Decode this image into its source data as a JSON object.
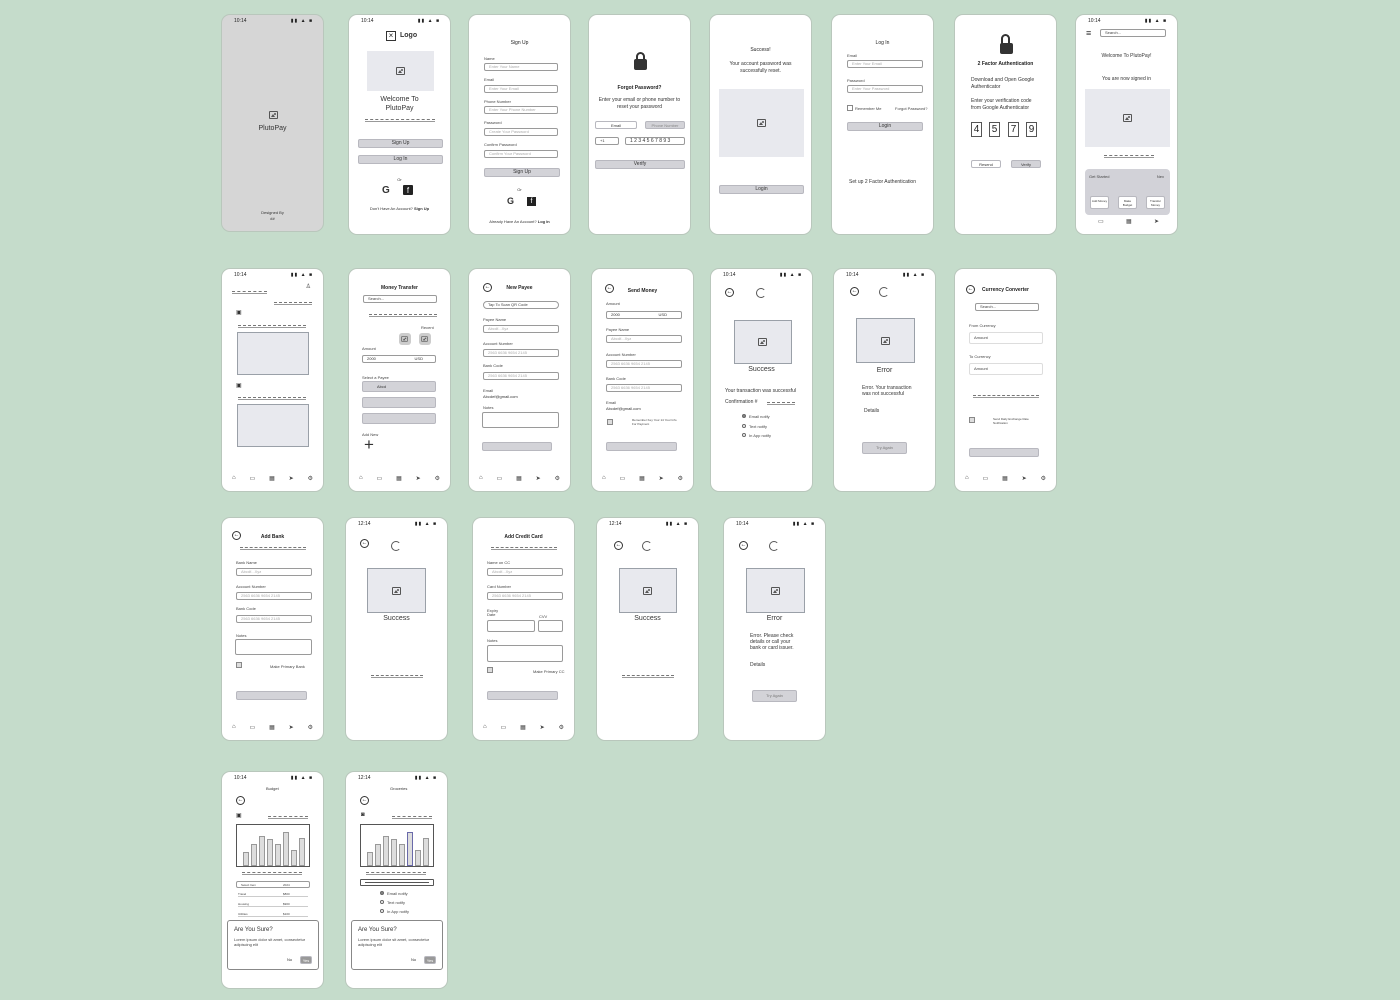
{
  "time": "10:14",
  "time_alt": "12:14",
  "status_icons": "▮▮ ▲ ■",
  "icons": {
    "image": "image-icon",
    "google": "G",
    "facebook": "f",
    "lock": "lock-icon",
    "menu": "≡",
    "plus": "+",
    "back": "←",
    "eye": "◉",
    "chevron": "∨"
  },
  "splash": {
    "brand": "PlutoPay",
    "designed_by": "Designed By",
    "designer": "##"
  },
  "welcome": {
    "logo": "Logo",
    "title": "Welcome To PlutoPay",
    "signup": "Sign Up",
    "login": "Log In",
    "or": "Or",
    "footer": "Don't Have An Account?",
    "footer_link": "Sign Up"
  },
  "signup": {
    "title": "Sign Up",
    "name_label": "Name",
    "name_ph": "Enter Your Name",
    "email_label": "Email",
    "email_ph": "Enter Your Email",
    "phone_label": "Phone Number",
    "phone_ph": "Enter Your Phone Number",
    "password_label": "Password",
    "password_ph": "Create Your Password",
    "confirm_label": "Confirm Password",
    "confirm_ph": "Confirm Your Password",
    "button": "Sign Up",
    "or": "Or",
    "footer": "Already Have An Account?",
    "footer_link": "Log In"
  },
  "forgot": {
    "title": "Forgot Password?",
    "desc": "Enter your email or phone number to reset your password",
    "tab_email": "Email",
    "tab_phone": "Phone Number",
    "code": "+1",
    "phone": "1 2 3 4 5 6 7 8 9 3",
    "button": "Verify"
  },
  "success_reset": {
    "title": "Success!",
    "desc": "Your account password was successfully reset.",
    "button": "Login"
  },
  "login": {
    "title": "Log In",
    "email_label": "Email",
    "email_ph": "Enter Your Email",
    "password_label": "Password",
    "password_ph": "Enter Your Password",
    "remember": "Remember Me",
    "forgot": "Forgot Password?",
    "button": "Login",
    "twofa": "Set up 2 Factor Authentication"
  },
  "twofa": {
    "title": "2 Factor Authentication",
    "desc1": "Download and Open Google Authenticator",
    "desc2": "Enter your verification code from Google Authenticator",
    "digits": [
      "4",
      "5",
      "7",
      "9"
    ],
    "resend": "Resend",
    "verify": "Verify"
  },
  "home": {
    "search_ph": "Search...",
    "title": "Welcome To PlutoPay!",
    "subtitle": "You are now signed in",
    "card_title": "Get Started",
    "card_step": "Nex",
    "actions": [
      "Add Money",
      "Make Budget",
      "Transfer Money"
    ]
  },
  "transfer": {
    "title": "Money Transfer",
    "search_ph": "Search...",
    "recent": "Recent",
    "amount_label": "Amount",
    "amount": "2000",
    "currency": "USD",
    "payee_label": "Select a Payee",
    "payee": "Abcd",
    "add_new": "Add New"
  },
  "newpayee": {
    "title": "New Payee",
    "scan": "Tap To Scan QR Code",
    "payee_label": "Payee Name",
    "payee_ph": "Abcdf...Xyz",
    "account_label": "Account Number",
    "account_ph": "2563 6636 9654 2145",
    "bank_label": "Bank Code",
    "bank_ph": "2563 6636 9654 2145",
    "email_label": "Email",
    "email": "Abcdef@gmail.com",
    "notes_label": "Notes"
  },
  "send": {
    "title": "Send Money",
    "amount_label": "Amount",
    "amount": "2000",
    "currency": "USD",
    "payee_label": "Payee Name",
    "payee_ph": "Abcdf...Xyz",
    "account_label": "Account Number",
    "account_ph": "2563 6636 9654 2145",
    "bank_label": "Bank Code",
    "bank_ph": "2563 6636 9654 2145",
    "email_label": "Email",
    "email": "Abcdef@gmail.com",
    "remember": "Remember Key Your 14 Your Info For Payment"
  },
  "tx_success": {
    "title": "Success",
    "desc": "Your transaction was successful",
    "conf": "Confirmation #",
    "opts": [
      "Email notify",
      "Text notify",
      "In App notify"
    ]
  },
  "tx_error": {
    "title": "Error",
    "desc": "Error. Your transaction was not successful",
    "details": "Details",
    "button": "Try Again"
  },
  "converter": {
    "title": "Currency Converter",
    "search_ph": "Search...",
    "from_label": "From Currency",
    "from_val": "Amount",
    "to_label": "To Currency",
    "to_val": "Amount",
    "check": "Send Daily Exchange Rate Notification"
  },
  "addbank": {
    "title": "Add Bank",
    "name_label": "Bank Name",
    "name_ph": "Abcdf...Xyz",
    "account_label": "Account Number",
    "account_ph": "2563 6636 9654 2145",
    "code_label": "Bank Code",
    "code_ph": "2563 6636 9654 2145",
    "notes_label": "Notes",
    "primary": "Make Primary Bank"
  },
  "bank_success": {
    "title": "Success"
  },
  "addcard": {
    "title": "Add Credit Card",
    "name_label": "Name on CC",
    "name_ph": "Abcdf...Xyz",
    "card_label": "Card Number",
    "card_ph": "2563 6636 9654 2145",
    "expiry_label": "Expiry Date",
    "cvv_label": "CVV",
    "notes_label": "Notes",
    "primary": "Make Primary CC"
  },
  "card_success": {
    "title": "Success"
  },
  "card_error": {
    "title": "Error",
    "desc": "Error. Please check details or call your bank or card issuer.",
    "details": "Details",
    "button": "Try Again"
  },
  "budget": {
    "title": "Budget",
    "table": [
      [
        "Select Item",
        "2024"
      ],
      [
        "Travel",
        "$800"
      ],
      [
        "Housing",
        "$900"
      ],
      [
        "Utilities",
        "$100"
      ]
    ],
    "dialog_title": "Are You Sure?",
    "dialog_text": "Lorem ipsum dolor sit amet, consectetur adipiscing elit",
    "no": "No",
    "yes": "Yes"
  },
  "groceries": {
    "title": "Groceries",
    "opts": [
      "Email notify",
      "Text notify",
      "In App notify"
    ],
    "dialog_title": "Are You Sure?",
    "dialog_text": "Lorem ipsum dolor sit amet, consectetur adipiscing elit",
    "no": "No",
    "yes": "Yes"
  }
}
